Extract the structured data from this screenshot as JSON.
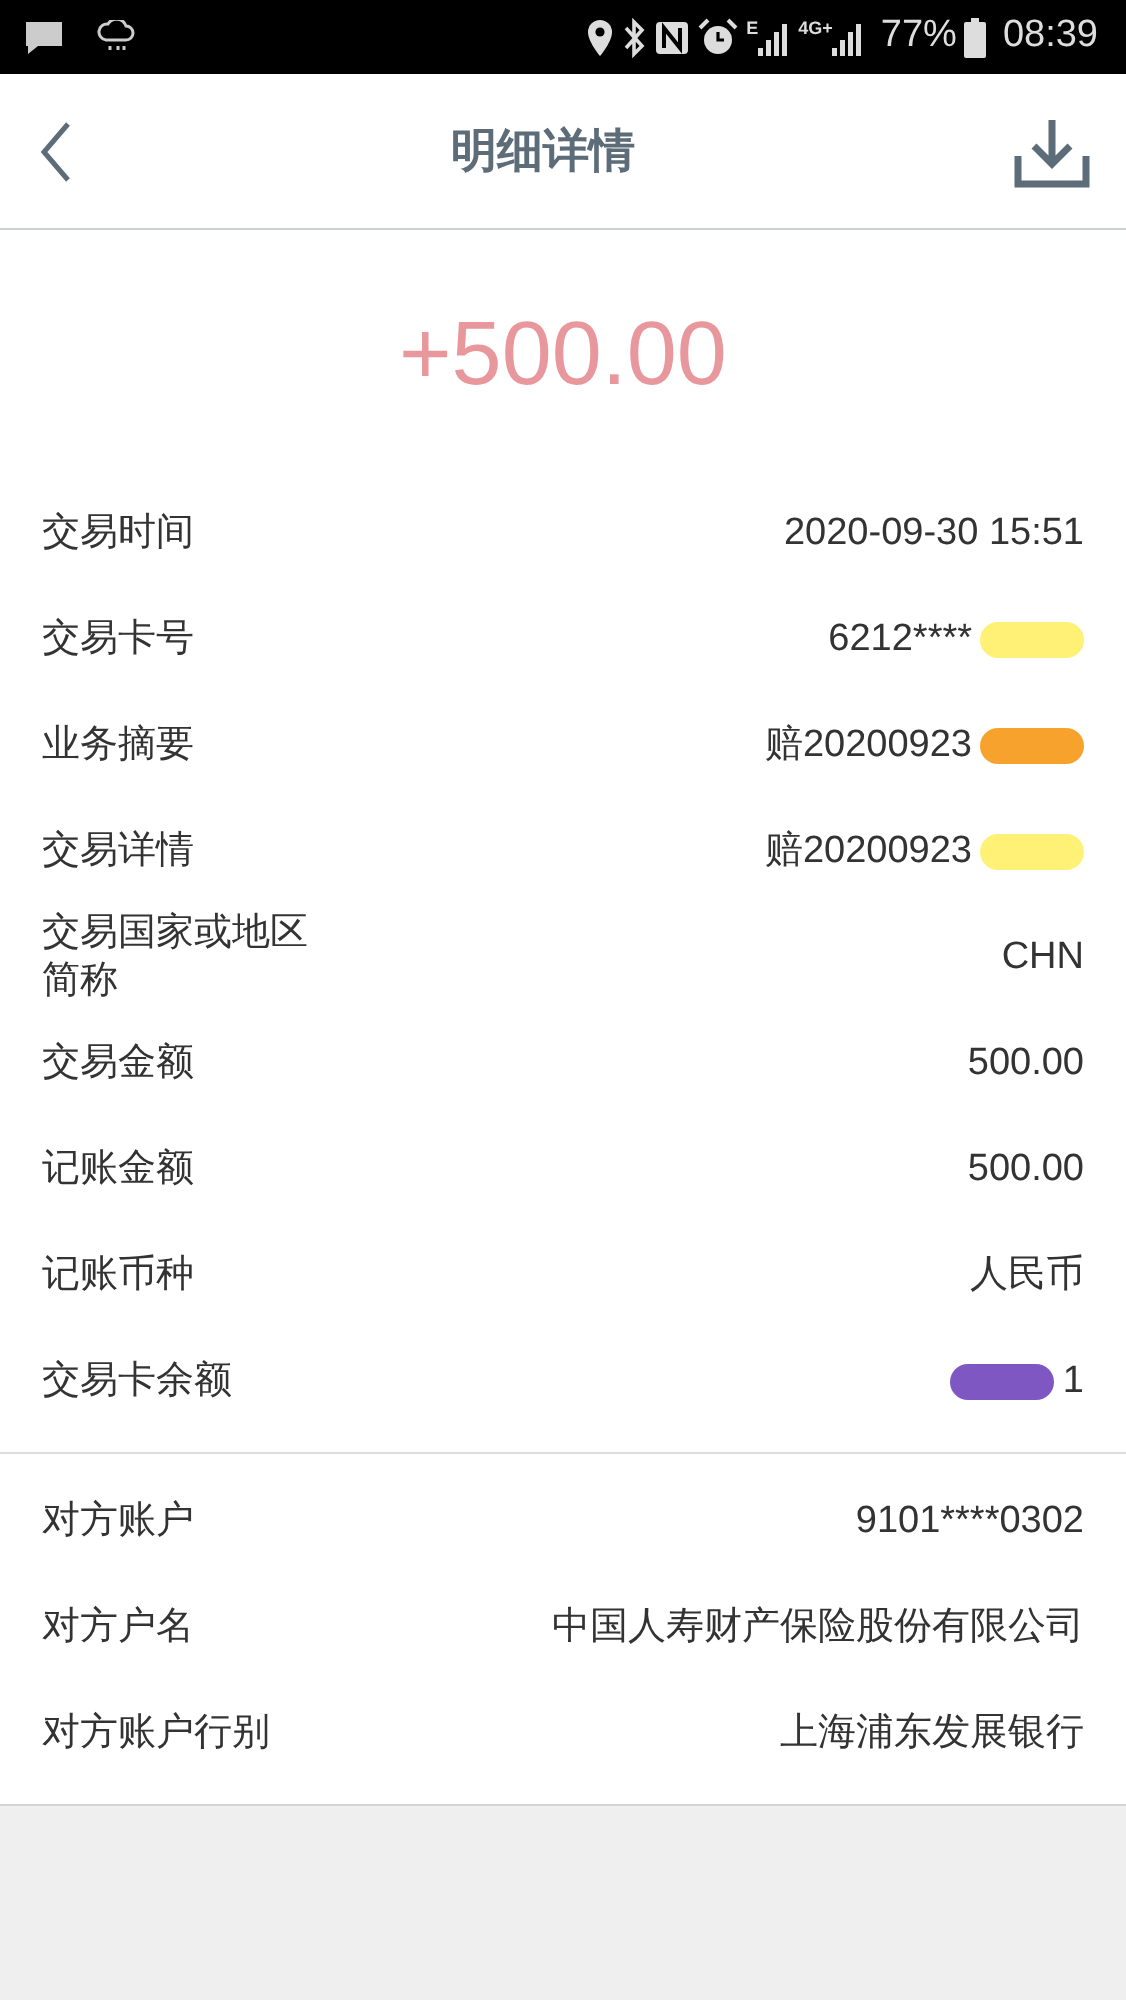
{
  "status_bar": {
    "network_labels": [
      "E",
      "4G+"
    ],
    "battery": "77%",
    "time": "08:39"
  },
  "header": {
    "title": "明细详情"
  },
  "amount": "+500.00",
  "groups": [
    {
      "rows": [
        {
          "label": "交易时间",
          "value": "2020-09-30 15:51"
        },
        {
          "label": "交易卡号",
          "value": "6212****",
          "redaction": {
            "color": "#fff176"
          }
        },
        {
          "label": "业务摘要",
          "value": "赔20200923",
          "redaction": {
            "color": "#f7a22c"
          }
        },
        {
          "label": "交易详情",
          "value": "赔20200923",
          "redaction": {
            "color": "#fff176"
          }
        },
        {
          "label": "交易国家或地区简称",
          "value": "CHN"
        },
        {
          "label": "交易金额",
          "value": "500.00"
        },
        {
          "label": "记账金额",
          "value": "500.00"
        },
        {
          "label": "记账币种",
          "value": "人民币"
        },
        {
          "label": "交易卡余额",
          "value": "1",
          "redaction": {
            "color": "#7e57c2",
            "leading": true
          }
        }
      ]
    },
    {
      "rows": [
        {
          "label": "对方账户",
          "value": "9101****0302"
        },
        {
          "label": "对方户名",
          "value": "中国人寿财产保险股份有限公司"
        },
        {
          "label": "对方账户行别",
          "value": "上海浦东发展银行"
        }
      ]
    }
  ]
}
